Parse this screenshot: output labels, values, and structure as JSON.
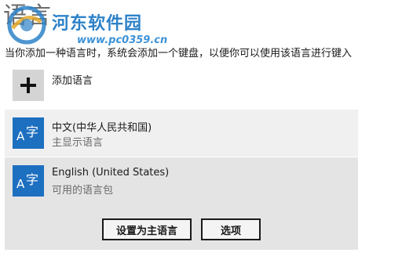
{
  "page": {
    "title": "语言",
    "description": "当你添加一种语言时，系统会添加一个键盘，以便你可以使用该语言进行键入"
  },
  "watermark": {
    "name": "河东软件园",
    "url": "www.pc0359.cn"
  },
  "add_language": {
    "icon": "plus-icon",
    "label": "添加语言"
  },
  "languages": [
    {
      "icon": "language-icon",
      "icon_letter": "A",
      "icon_glyph": "字",
      "name": "中文(中华人民共和国)",
      "status": "主显示语言"
    },
    {
      "icon": "language-icon",
      "icon_letter": "A",
      "icon_glyph": "字",
      "name": "English (United States)",
      "status": "可用的语言包"
    }
  ],
  "actions": {
    "set_primary": "设置为主语言",
    "options": "选项"
  },
  "colors": {
    "accent": "#1d6fc0",
    "watermark": "#2d82c8"
  }
}
